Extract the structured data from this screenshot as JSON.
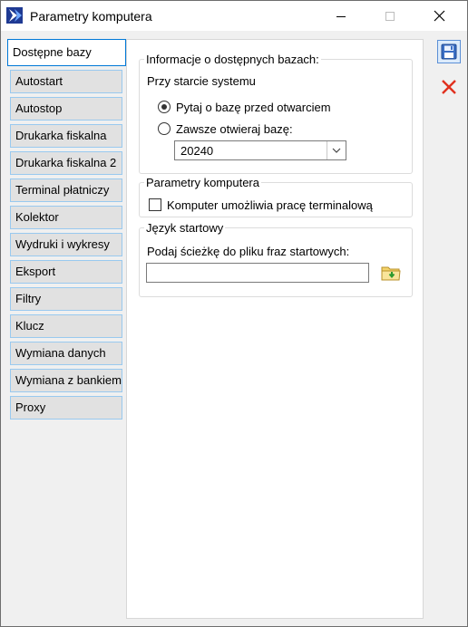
{
  "window": {
    "title": "Parametry komputera",
    "icon": "app-logo-icon",
    "controls": [
      "minimize-icon",
      "maximize-icon",
      "close-icon"
    ]
  },
  "tabs": [
    {
      "label": "Dostępne bazy",
      "active": true
    },
    {
      "label": "Autostart"
    },
    {
      "label": "Autostop"
    },
    {
      "label": "Drukarka fiskalna"
    },
    {
      "label": "Drukarka fiskalna 2"
    },
    {
      "label": "Terminal płatniczy"
    },
    {
      "label": "Kolektor"
    },
    {
      "label": "Wydruki i wykresy"
    },
    {
      "label": "Eksport"
    },
    {
      "label": "Filtry"
    },
    {
      "label": "Klucz"
    },
    {
      "label": "Wymiana danych"
    },
    {
      "label": "Wymiana z bankiem"
    },
    {
      "label": "Proxy"
    }
  ],
  "databases_group": {
    "legend": "Informacje o dostępnych bazach:",
    "startup_label": "Przy starcie systemu",
    "option_ask": "Pytaj o bazę przed otwarciem",
    "option_ask_selected": true,
    "option_always": "Zawsze otwieraj bazę:",
    "option_always_selected": false,
    "database_value": "20240"
  },
  "computer_group": {
    "legend": "Parametry komputera",
    "terminal_label": "Komputer umożliwia pracę terminalową",
    "terminal_checked": false
  },
  "language_group": {
    "legend": "Język startowy",
    "path_label": "Podaj ścieżkę do pliku fraz startowych:",
    "path_value": "",
    "browse_icon": "folder-open-icon"
  },
  "side_buttons": {
    "save_icon": "save-icon",
    "cancel_icon": "cancel-icon"
  },
  "colors": {
    "active_tab_border": "#0078d7",
    "tab_border": "#99c9ef",
    "tab_bg": "#e1e1e1",
    "cancel_red": "#e0301e",
    "save_blue": "#3b6fc4"
  }
}
